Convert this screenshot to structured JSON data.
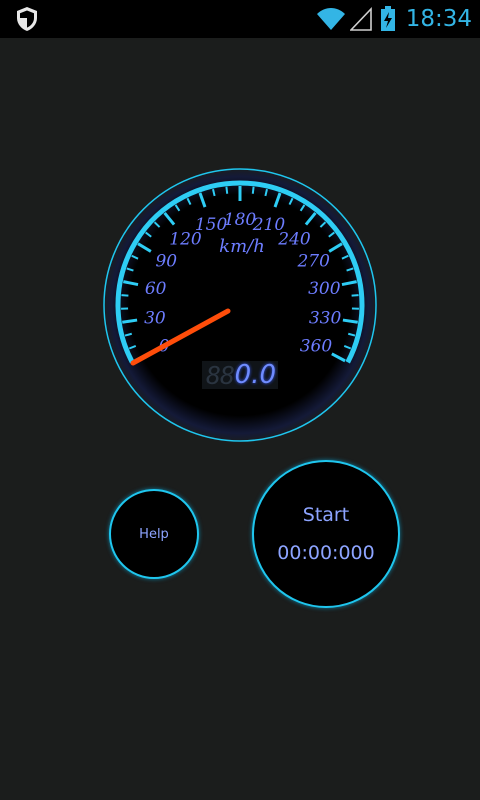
{
  "statusbar": {
    "time": "18:34",
    "icons": [
      "shield-icon",
      "wifi-icon",
      "signal-icon",
      "battery-charging-icon"
    ]
  },
  "speedometer": {
    "unit": "km/h",
    "scale_labels": [
      "0",
      "30",
      "60",
      "90",
      "120",
      "150",
      "180",
      "210",
      "240",
      "270",
      "300",
      "330",
      "360"
    ],
    "ghost_digits": "88",
    "speed_display": "0.0",
    "needle_value_kmh": 35,
    "accent_color": "#1fc6ee",
    "label_color": "#6d7dff",
    "needle_color": "#ff4d0a"
  },
  "controls": {
    "help_label": "Help",
    "start_label": "Start",
    "timer": "00:00:000"
  }
}
